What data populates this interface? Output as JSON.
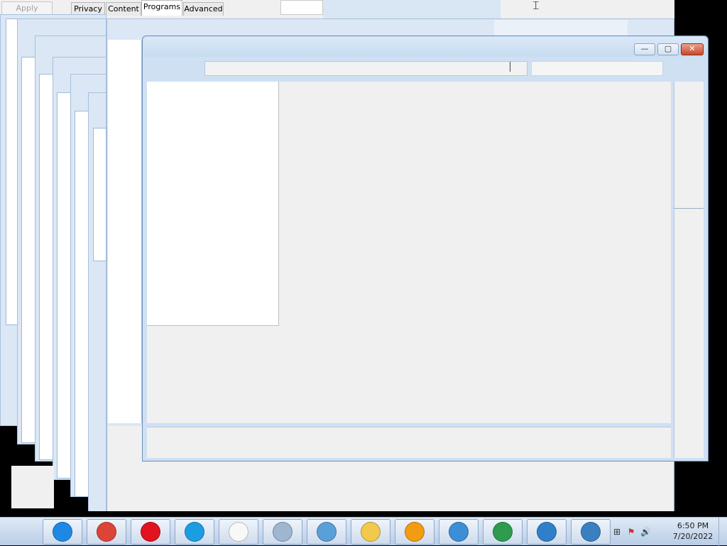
{
  "background_dialog": {
    "apply_label": "Apply",
    "tabs": [
      "Privacy",
      "Content",
      "Programs",
      "Advanced"
    ],
    "active_tab": "Programs"
  },
  "main_window": {
    "controls": {
      "minimize": "—",
      "maximize": "▢",
      "close": "✕"
    },
    "address_value": "",
    "search_value": ""
  },
  "taskbar": {
    "apps": [
      {
        "name": "Internet Explorer",
        "icon": "ie-icon",
        "color": "#1e88e5"
      },
      {
        "name": "Google Chrome",
        "icon": "chrome-icon",
        "color": "#db4437"
      },
      {
        "name": "Opera",
        "icon": "opera-icon",
        "color": "#e0131f"
      },
      {
        "name": "Microsoft Edge",
        "icon": "edge-icon",
        "color": "#1b9de2"
      },
      {
        "name": "Notepad",
        "icon": "notepad-icon",
        "color": "#f8f8f8"
      },
      {
        "name": "Calculator",
        "icon": "calculator-icon",
        "color": "#9fb6d0"
      },
      {
        "name": "Media Center",
        "icon": "media-icon",
        "color": "#5aa0d8"
      },
      {
        "name": "Windows Explorer",
        "icon": "folder-icon",
        "color": "#f2c94c"
      },
      {
        "name": "Media Player",
        "icon": "media-player-icon",
        "color": "#f39c12"
      },
      {
        "name": "Control Panel",
        "icon": "control-panel-icon",
        "color": "#3c8fd6"
      },
      {
        "name": "Internet Options",
        "icon": "internet-options-icon",
        "color": "#2e9b4f"
      },
      {
        "name": "Remote Desktop",
        "icon": "remote-desktop-icon",
        "color": "#2f80c9"
      },
      {
        "name": "Virtual PC",
        "icon": "virtual-pc-icon",
        "color": "#3a7fc0"
      }
    ],
    "clock": {
      "time": "6:50 PM",
      "date": "7/20/2022"
    }
  }
}
